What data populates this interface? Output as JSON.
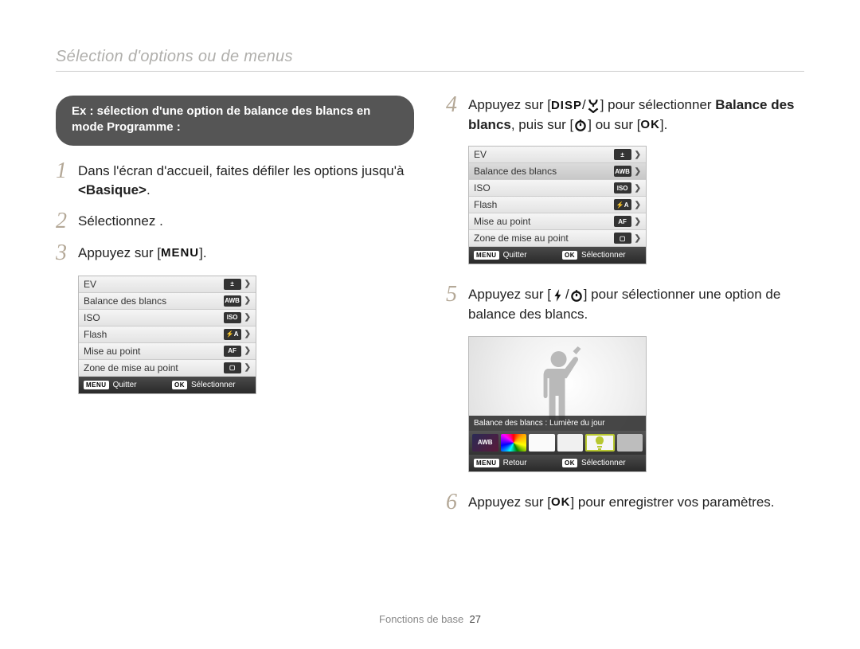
{
  "title": "Sélection d'options ou de menus",
  "lozenge": "Ex : sélection d'une option de balance des blancs en mode Programme :",
  "steps": {
    "s1a": "Dans l'écran d'accueil, faites défiler les options jusqu'à ",
    "s1b": "<Basique>",
    "s1c": ".",
    "s2a": "Sélectionnez ",
    "s2b": " .",
    "s3a": "Appuyez sur [",
    "s3b": "].",
    "s4a": "Appuyez sur [",
    "s4b": "] pour sélectionner ",
    "s4c": "Balance des blancs",
    "s4d": ", puis sur [",
    "s4e": "] ou sur [",
    "s4f": "].",
    "s5a": "Appuyez sur [",
    "s5b": "] pour sélectionner une option de balance des blancs.",
    "s6a": "Appuyez sur [",
    "s6b": "] pour enregistrer vos paramètres."
  },
  "glyphs": {
    "menu": "MENU",
    "ok": "OK",
    "disp": "DISP",
    "slash": "/"
  },
  "menu": {
    "items": [
      {
        "label": "EV",
        "icon": "±"
      },
      {
        "label": "Balance des blancs",
        "icon": "AWB"
      },
      {
        "label": "ISO",
        "icon": "ISO"
      },
      {
        "label": "Flash",
        "icon": "⚡A"
      },
      {
        "label": "Mise au point",
        "icon": "AF"
      },
      {
        "label": "Zone de mise au point",
        "icon": "▢"
      }
    ],
    "quit": "Quitter",
    "select": "Sélectionner"
  },
  "wb": {
    "caption": "Balance des blancs : Lumière du jour",
    "back": "Retour",
    "select": "Sélectionner"
  },
  "footer": {
    "label": "Fonctions de base",
    "page": "27"
  }
}
